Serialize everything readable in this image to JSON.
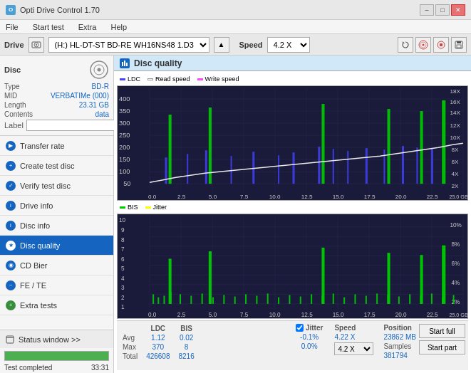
{
  "titlebar": {
    "title": "Opti Drive Control 1.70",
    "icon_label": "O",
    "min_label": "–",
    "max_label": "□",
    "close_label": "✕"
  },
  "menubar": {
    "items": [
      "File",
      "Start test",
      "Extra",
      "Help"
    ]
  },
  "drivebar": {
    "label": "Drive",
    "drive_value": "(H:) HL-DT-ST BD-RE  WH16NS48 1.D3",
    "speed_label": "Speed",
    "speed_value": "4.2 X"
  },
  "disc": {
    "title": "Disc",
    "type_label": "Type",
    "type_value": "BD-R",
    "mid_label": "MID",
    "mid_value": "VERBATIMe (000)",
    "length_label": "Length",
    "length_value": "23.31 GB",
    "contents_label": "Contents",
    "contents_value": "data",
    "label_label": "Label"
  },
  "nav": {
    "items": [
      {
        "id": "transfer-rate",
        "label": "Transfer rate",
        "active": false
      },
      {
        "id": "create-test-disc",
        "label": "Create test disc",
        "active": false
      },
      {
        "id": "verify-test-disc",
        "label": "Verify test disc",
        "active": false
      },
      {
        "id": "drive-info",
        "label": "Drive info",
        "active": false
      },
      {
        "id": "disc-info",
        "label": "Disc info",
        "active": false
      },
      {
        "id": "disc-quality",
        "label": "Disc quality",
        "active": true
      },
      {
        "id": "cd-bier",
        "label": "CD Bier",
        "active": false
      },
      {
        "id": "fe-te",
        "label": "FE / TE",
        "active": false
      },
      {
        "id": "extra-tests",
        "label": "Extra tests",
        "active": false
      }
    ]
  },
  "status_window": {
    "label": "Status window >>",
    "progress_pct": 100,
    "status_text": "Test completed",
    "time_text": "33:31"
  },
  "chart": {
    "title": "Disc quality",
    "legend_top": [
      {
        "label": "LDC",
        "color": "#4444ff"
      },
      {
        "label": "Read speed",
        "color": "#ffffff"
      },
      {
        "label": "Write speed",
        "color": "#ff44ff"
      }
    ],
    "legend_bottom": [
      {
        "label": "BIS",
        "color": "#00cc00"
      },
      {
        "label": "Jitter",
        "color": "#ffff00"
      }
    ],
    "y_axis_left_top": [
      "400",
      "350",
      "300",
      "250",
      "200",
      "150",
      "100",
      "50"
    ],
    "y_axis_right_top": [
      "18X",
      "16X",
      "14X",
      "12X",
      "10X",
      "8X",
      "6X",
      "4X",
      "2X"
    ],
    "y_axis_left_bottom": [
      "10",
      "9",
      "8",
      "7",
      "6",
      "5",
      "4",
      "3",
      "2",
      "1"
    ],
    "y_axis_right_bottom": [
      "10%",
      "8%",
      "6%",
      "4%",
      "2%"
    ],
    "x_axis": [
      "0.0",
      "2.5",
      "5.0",
      "7.5",
      "10.0",
      "12.5",
      "15.0",
      "17.5",
      "20.0",
      "22.5",
      "25.0 GB"
    ]
  },
  "stats": {
    "col_ldc": "LDC",
    "col_bis": "BIS",
    "col_jitter": "Jitter",
    "col_speed": "Speed",
    "col_position": "Position",
    "row_avg": {
      "label": "Avg",
      "ldc": "1.12",
      "bis": "0.02",
      "jitter": "-0.1%"
    },
    "row_max": {
      "label": "Max",
      "ldc": "370",
      "bis": "8",
      "jitter": "0.0%"
    },
    "row_total": {
      "label": "Total",
      "ldc": "426608",
      "bis": "8216"
    },
    "speed_val": "4.22 X",
    "position_val": "23862 MB",
    "samples_val": "381794",
    "jitter_checked": true,
    "speed_dropdown": "4.2 X",
    "start_full_label": "Start full",
    "start_part_label": "Start part"
  }
}
